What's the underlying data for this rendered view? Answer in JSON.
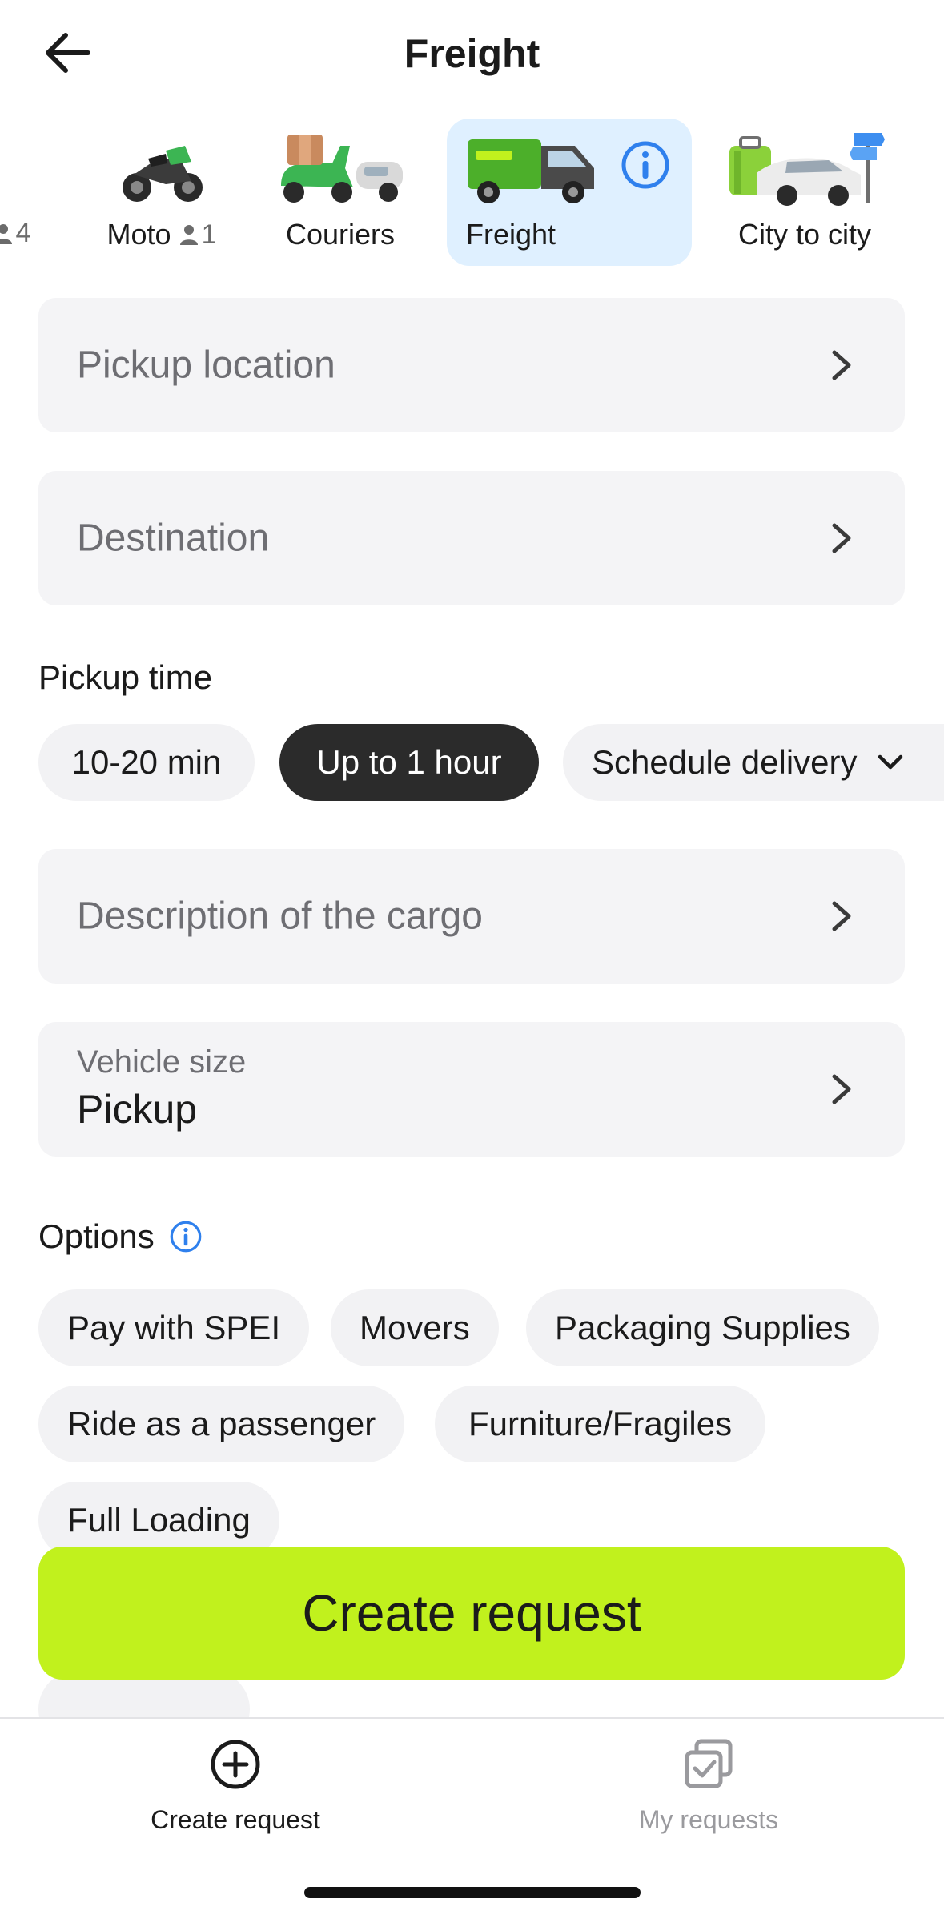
{
  "header": {
    "title": "Freight"
  },
  "services": [
    {
      "label": "",
      "seats": "4"
    },
    {
      "label": "Moto",
      "seats": "1"
    },
    {
      "label": "Couriers"
    },
    {
      "label": "Freight",
      "selected": true
    },
    {
      "label": "City to city"
    }
  ],
  "fields": {
    "pickup_placeholder": "Pickup location",
    "destination_placeholder": "Destination",
    "cargo_placeholder": "Description of the cargo",
    "vehicle_size_label": "Vehicle size",
    "vehicle_size_value": "Pickup"
  },
  "pickup_time": {
    "title": "Pickup time",
    "options": [
      "10-20 min",
      "Up to 1 hour",
      "Schedule delivery"
    ],
    "selected": "Up to 1 hour"
  },
  "options": {
    "title": "Options",
    "chips": [
      "Pay with SPEI",
      "Movers",
      "Packaging Supplies",
      "Ride as a passenger",
      "Furniture/Fragiles",
      "Full Loading"
    ]
  },
  "cta": {
    "label": "Create request"
  },
  "tabbar": {
    "items": [
      "Create request",
      "My requests"
    ],
    "active": "Create request"
  },
  "colors": {
    "accent": "#c1f11d",
    "selected_bg": "#dff0ff",
    "info_blue": "#2f80ed",
    "chip_dark": "#2b2b2b"
  },
  "icons": [
    "back-arrow-icon",
    "info-icon",
    "chevron-right-icon",
    "chevron-down-icon",
    "person-icon",
    "plus-circle-icon",
    "requests-icon"
  ]
}
